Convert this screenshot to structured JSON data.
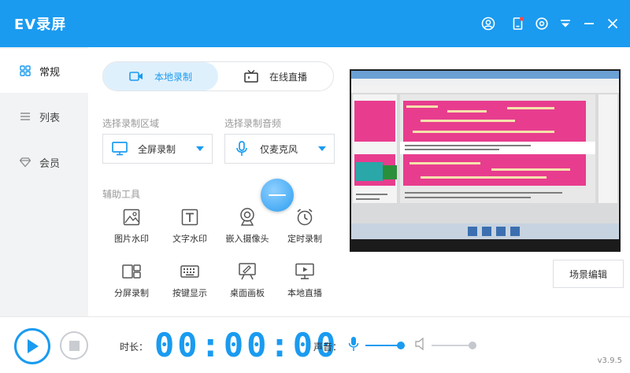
{
  "app": {
    "title": "EV录屏",
    "version": "v3.9.5"
  },
  "sidebar": {
    "items": [
      {
        "label": "常规",
        "icon": "grid-icon",
        "active": true
      },
      {
        "label": "列表",
        "icon": "list-icon",
        "active": false
      },
      {
        "label": "会员",
        "icon": "diamond-icon",
        "active": false
      }
    ]
  },
  "tabs": {
    "local": "本地录制",
    "live": "在线直播"
  },
  "record_area": {
    "label": "选择录制区域",
    "value": "全屏录制"
  },
  "record_audio": {
    "label": "选择录制音频",
    "value": "仅麦克风"
  },
  "tools": {
    "title": "辅助工具",
    "items": [
      {
        "label": "图片水印",
        "icon": "image-icon"
      },
      {
        "label": "文字水印",
        "icon": "text-icon"
      },
      {
        "label": "嵌入摄像头",
        "icon": "webcam-icon"
      },
      {
        "label": "定时录制",
        "icon": "alarm-clock-icon"
      },
      {
        "label": "分屏录制",
        "icon": "split-screen-icon"
      },
      {
        "label": "按键显示",
        "icon": "keyboard-icon"
      },
      {
        "label": "桌面画板",
        "icon": "drawing-board-icon"
      },
      {
        "label": "本地直播",
        "icon": "monitor-play-icon"
      }
    ]
  },
  "scene_button": "场景编辑",
  "bottom": {
    "duration_label": "时长：",
    "timer": "00:00:00",
    "volume_label": "声音：",
    "mic_level": 0.9,
    "speaker_level": 1.0
  },
  "colors": {
    "accent": "#1a9bf0",
    "titlebar": "#1a9bf0",
    "preview_pink": "#e83d8f"
  }
}
